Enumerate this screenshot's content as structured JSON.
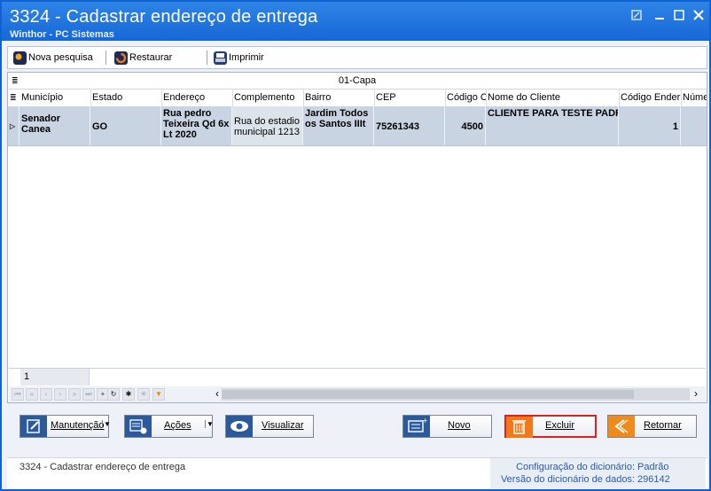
{
  "window": {
    "title": "3324 - Cadastrar endereço de entrega",
    "subtitle": "Winthor - PC Sistemas"
  },
  "toolbar": {
    "nova_pesquisa": "Nova pesquisa",
    "restaurar": "Restaurar",
    "imprimir": "Imprimir"
  },
  "grid": {
    "caption": "01-Capa",
    "columns": [
      "Município",
      "Estado",
      "Endereço",
      "Complemento",
      "Bairro",
      "CEP",
      "Código C",
      "Nome do Cliente",
      "Código Ender",
      "Núme"
    ],
    "row": {
      "municipio": "Senador Canea",
      "estado": "GO",
      "endereco": "Rua pedro Teixeira Qd 6x Lt 2020",
      "complemento": "Rua do estadio municipal 1213",
      "bairro": "Jardim Todos os Santos IIIt",
      "cep": "75261343",
      "codigo_c": "4500",
      "nome_cliente": "CLIENTE PARA TESTE PADR",
      "codigo_ender": "1",
      "numero": ""
    },
    "record_count": "1"
  },
  "buttons": {
    "manutencao": "Manutenção",
    "acoes": "Ações",
    "visualizar": "Visualizar",
    "novo": "Novo",
    "excluir": "Excluir",
    "retornar": "Retornar"
  },
  "status": {
    "left": "3324 - Cadastrar endereço de entrega",
    "config_label": "Configuração do dicionário:",
    "config_value": "Padrão",
    "version_label": "Versão do dicionário de dados:",
    "version_value": "296142"
  },
  "colors": {
    "titlebar": "#1f74de",
    "excluir_border": "#e0201c",
    "link_blue": "#2b5aa8"
  }
}
